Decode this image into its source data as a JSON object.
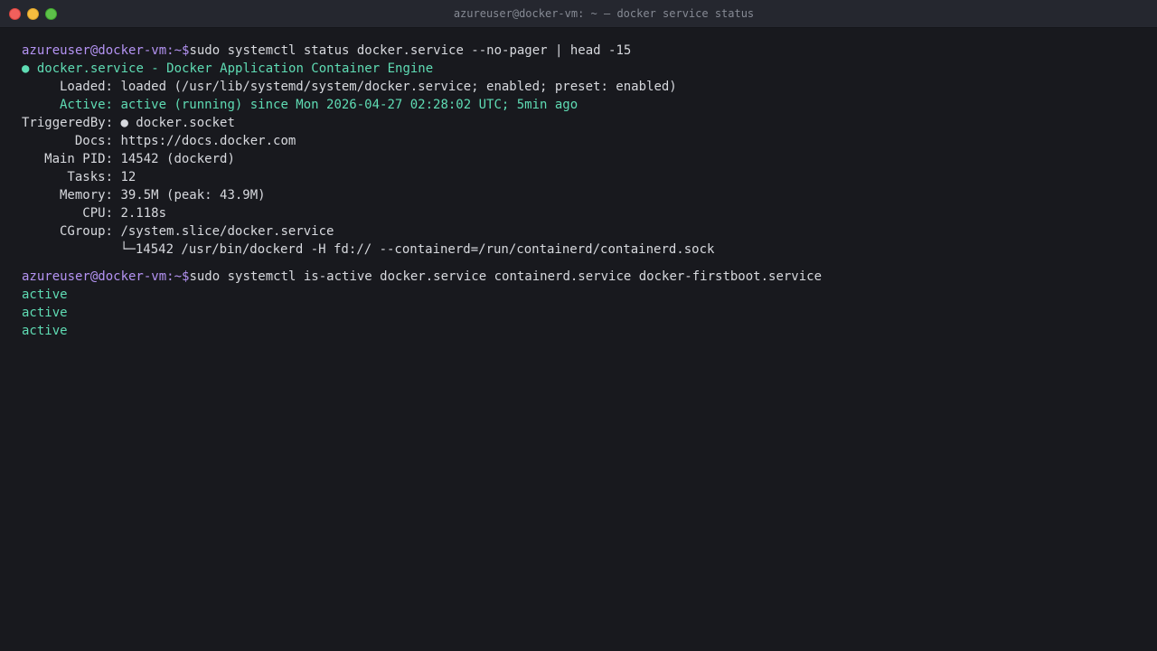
{
  "window": {
    "title": "azureuser@docker-vm: ~ — docker service status"
  },
  "terminal": {
    "prompt": "azureuser@docker-vm:~$",
    "command1": "sudo systemctl status docker.service --no-pager | head -15",
    "status": {
      "bullet": "●",
      "unit_line": "docker.service - Docker Application Container Engine",
      "fields": [
        {
          "label": "Loaded:",
          "value": "loaded (/usr/lib/systemd/system/docker.service; enabled; preset: enabled)",
          "highlight": false
        },
        {
          "label": "Active:",
          "value": "active (running) since Mon 2026-04-27 02:28:02 UTC; 5min ago",
          "highlight": true
        },
        {
          "label": "TriggeredBy:",
          "value": "● docker.socket",
          "highlight": false
        },
        {
          "label": "Docs:",
          "value": "https://docs.docker.com",
          "highlight": false
        },
        {
          "label": "Main PID:",
          "value": "14542 (dockerd)",
          "highlight": false
        },
        {
          "label": "Tasks:",
          "value": "12",
          "highlight": false
        },
        {
          "label": "Memory:",
          "value": "39.5M (peak: 43.9M)",
          "highlight": false
        },
        {
          "label": "CPU:",
          "value": "2.118s",
          "highlight": false
        },
        {
          "label": "CGroup:",
          "value": "/system.slice/docker.service",
          "highlight": false
        }
      ],
      "cgroup_tree": "└─14542 /usr/bin/dockerd -H fd:// --containerd=/run/containerd/containerd.sock"
    },
    "command2": "sudo systemctl is-active docker.service containerd.service docker-firstboot.service",
    "results": [
      "active",
      "active",
      "active"
    ]
  },
  "colors": {
    "background": "#18191e",
    "titlebar": "#25272f",
    "prompt": "#b493f3",
    "success": "#5fdcb4",
    "text": "#d7d9de",
    "close_button": "#f0605c",
    "minimize_button": "#f6bd3f",
    "maximize_button": "#5dc149"
  }
}
